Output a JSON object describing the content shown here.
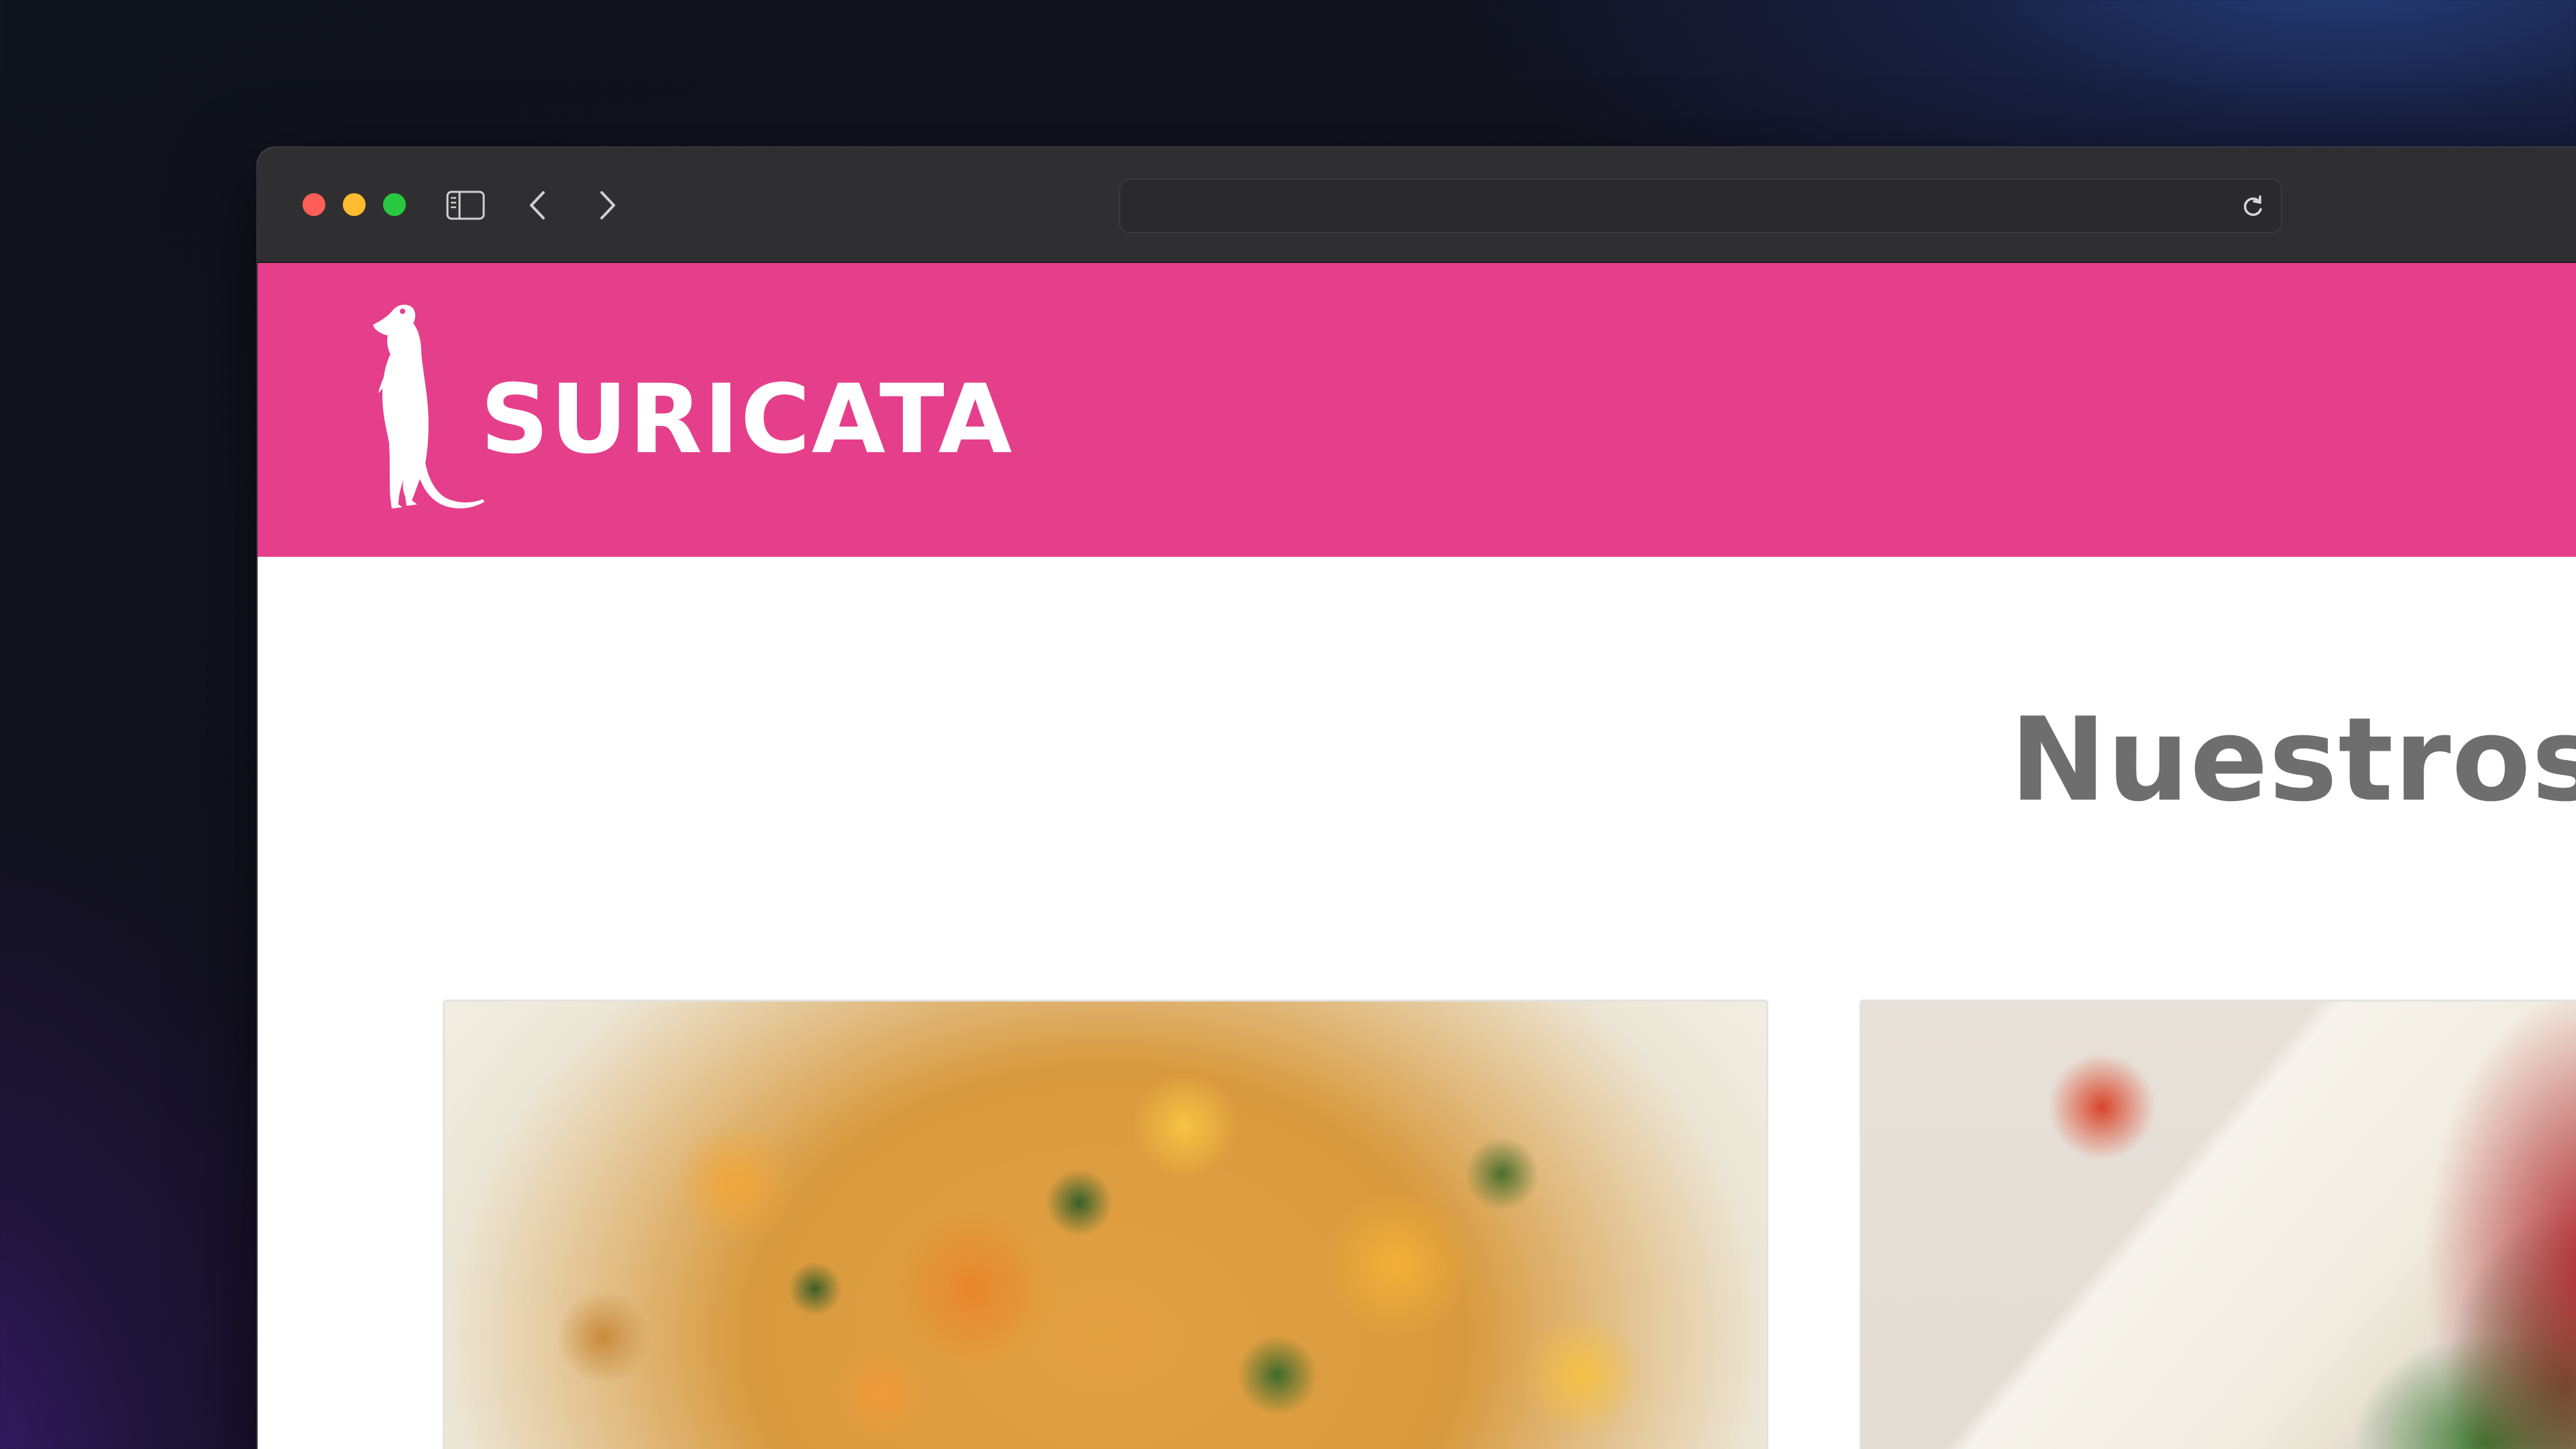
{
  "browser": {
    "url": "",
    "icons": {
      "sidebar": "sidebar-toggle-icon",
      "back": "chevron-left-icon",
      "forward": "chevron-right-icon",
      "reload": "reload-icon"
    }
  },
  "site": {
    "brand_name": "SURICATA",
    "brand_color": "#e53f8b",
    "logo_icon": "meerkat-logo-icon"
  },
  "main": {
    "section_title": "Nuestros p",
    "cards": [
      {
        "image": "food-photo"
      },
      {
        "image": "food-photo"
      }
    ]
  }
}
